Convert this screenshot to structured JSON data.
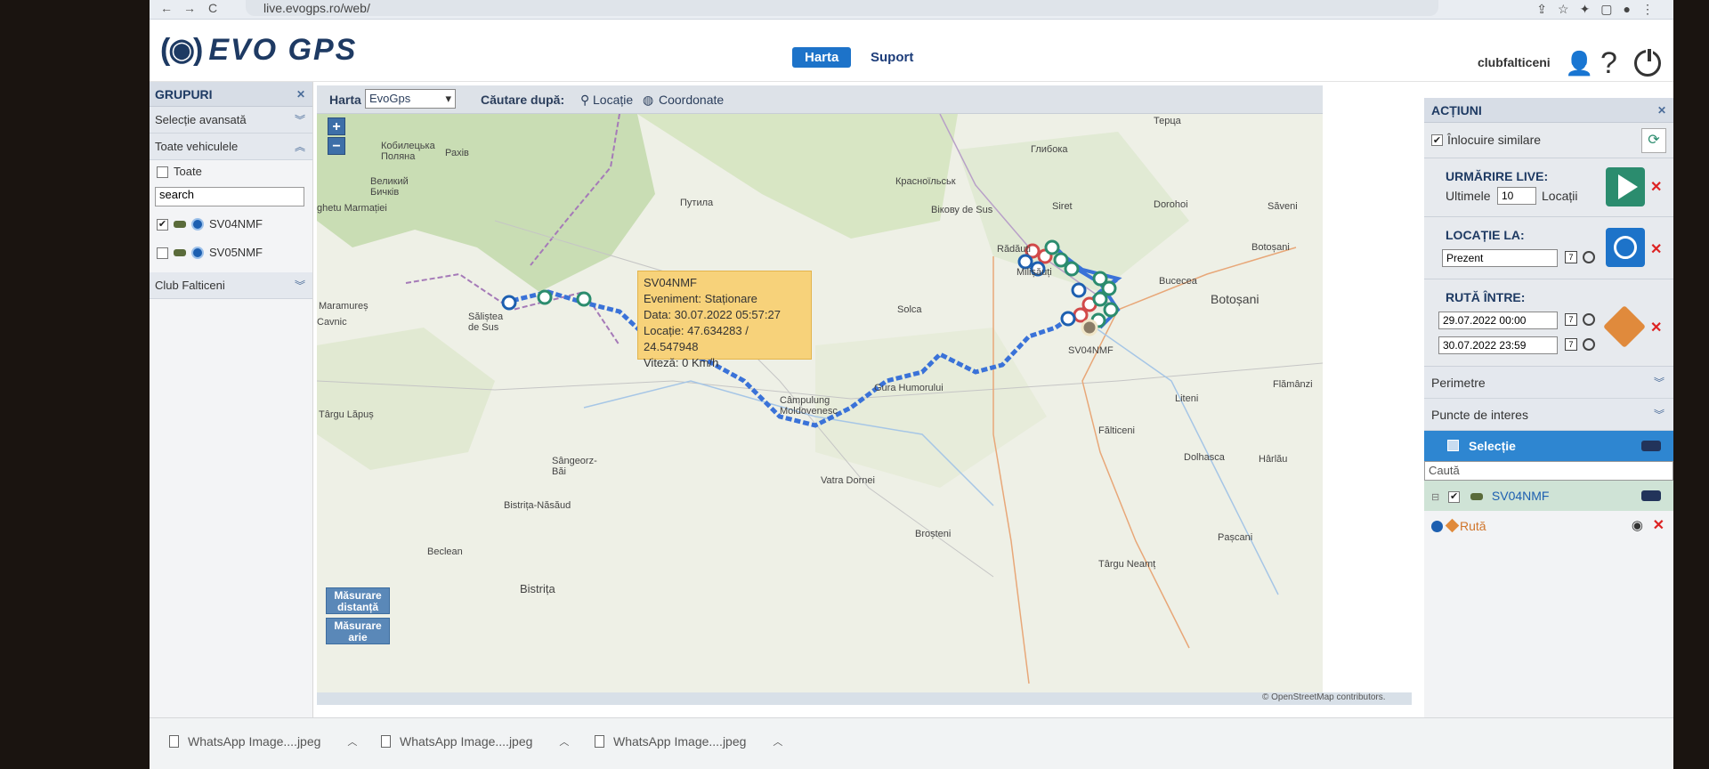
{
  "browser": {
    "url": "live.evogps.ro/web/",
    "nav_back": "←",
    "nav_forward": "→",
    "nav_reload": "C"
  },
  "header": {
    "logo_mark": "(◉)",
    "logo_text": "EVO GPS",
    "nav": {
      "harta": "Harta",
      "suport": "Suport"
    },
    "user": "clubfalticeni"
  },
  "left_panel": {
    "title": "GRUPURI",
    "advanced": "Selecție avansată",
    "all_vehicles": "Toate vehiculele",
    "all_label": "Toate",
    "search_value": "search",
    "vehicles": [
      {
        "name": "SV04NMF",
        "checked": "✔"
      },
      {
        "name": "SV05NMF",
        "checked": ""
      }
    ],
    "group": "Club Falticeni"
  },
  "map_toolbar": {
    "map_label": "Harta",
    "map_value": "EvoGps",
    "search_by": "Căutare după:",
    "opt_location": "Locație",
    "opt_coords": "Coordonate"
  },
  "map": {
    "zoom_in": "+",
    "zoom_out": "−",
    "labels": {
      "l1": "Кобилецька Поляна",
      "l2": "Рахів",
      "l3": "Великий Бичків",
      "l4": "ghetu Marmației",
      "l5": "Путила",
      "l6": "Красноїльськ",
      "l7": "Вікову de Sus",
      "l8": "Глибока",
      "l9": "Терца",
      "l10": "Siret",
      "l11": "Dorohoi",
      "l12": "Săveni",
      "l13": "Rădăuți",
      "l14": "Milișăuți",
      "l15": "Botoșani",
      "l16": "Bucecea",
      "l17": "Botoșani",
      "l18": "Solca",
      "l19": "Maramureș",
      "l20": "Cavnic",
      "l21": "Săliștea de Sus",
      "l22": "Câmpulung Moldovenesc",
      "l23": "Gura Humorului",
      "l24": "SV04NMF",
      "l25": "Liteni",
      "l26": "Flămânzi",
      "l27": "Târgu Lăpuș",
      "l28": "Fălticeni",
      "l29": "Dolhasca",
      "l30": "Hârlău",
      "l31": "Sângeorz-Băi",
      "l32": "Vatra Dornei",
      "l33": "Bistrița-Năsăud",
      "l34": "Broșteni",
      "l35": "Beclean",
      "l36": "Pașcani",
      "l37": "Bistrița",
      "l38": "Târgu Neamț"
    },
    "measure_distance": "Măsurare distanță",
    "measure_area": "Măsurare arie",
    "credit": "© OpenStreetMap contributors."
  },
  "popup": {
    "title": "SV04NMF",
    "event": "Eveniment: Staționare",
    "date": "Data: 30.07.2022 05:57:27",
    "location": "Locație: 47.634283 / 24.547948",
    "speed": "Viteză: 0 Km/h"
  },
  "right_panel": {
    "title": "ACȚIUNI",
    "replace_similar": "Înlocuire similare",
    "live_title": "URMĂRIRE LIVE:",
    "live_last": "Ultimele",
    "live_count": "10",
    "live_unit": "Locații",
    "loc_title": "LOCAȚIE LA:",
    "loc_value": "Prezent",
    "route_title": "RUTĂ ÎNTRE:",
    "route_from": "29.07.2022 00:00",
    "route_to": "30.07.2022 23:59",
    "perimeters": "Perimetre",
    "poi": "Puncte de interes",
    "selection": "Selecție",
    "search_placeholder": "Caută",
    "vehicle": "SV04NMF",
    "route": "Rută"
  },
  "downloads": [
    {
      "name": "WhatsApp Image....jpeg"
    },
    {
      "name": "WhatsApp Image....jpeg"
    },
    {
      "name": "WhatsApp Image....jpeg"
    }
  ],
  "colors": {
    "brand": "#1e3a63",
    "accent": "#1d73c9",
    "route": "#3a72d8",
    "popup": "#f7d27a",
    "live_btn": "#2b8c6e",
    "loc_btn": "#1d73c9",
    "route_btn": "#e08a3c"
  }
}
